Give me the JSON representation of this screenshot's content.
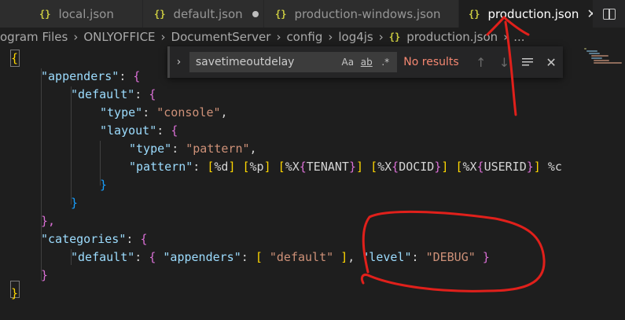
{
  "tabs": [
    {
      "label": "local.json",
      "state": "normal"
    },
    {
      "label": "default.json",
      "state": "modified"
    },
    {
      "label": "production-windows.json",
      "state": "normal"
    },
    {
      "label": "production.json",
      "state": "active"
    }
  ],
  "breadcrumb": {
    "items": [
      "ogram Files",
      "ONLYOFFICE",
      "DocumentServer",
      "config",
      "log4js",
      "production.json",
      "..."
    ]
  },
  "find_widget": {
    "query": "savetimeoutdelay",
    "match_case_label": "Aa",
    "whole_word_label": "ab",
    "regex_label": ".*",
    "status": "No results"
  },
  "code": {
    "lines": [
      "{",
      "\"appenders\": {",
      "\"default\": {",
      "\"type\": \"console\",",
      "\"layout\": {",
      "\"type\": \"pattern\",",
      "\"pattern\": \"[%d] [%p] [%X{TENANT}] [%X{DOCID}] [%X{USERID}] %c",
      "}",
      "}",
      "},",
      "\"categories\": {",
      "\"default\": { \"appenders\": [ \"default\" ], \"level\": \"DEBUG\" }",
      "}",
      "}"
    ]
  },
  "colors": {
    "annotation_red": "#e0201b",
    "no_results": "#f48771",
    "key": "#9cdcfe",
    "string": "#ce9178"
  }
}
